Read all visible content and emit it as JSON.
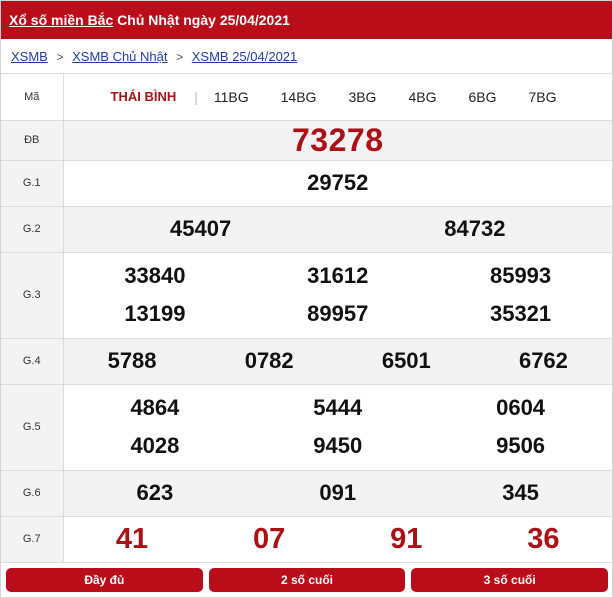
{
  "header": {
    "title_link": "Xổ số miền Bắc",
    "title_rest": " Chủ Nhật ngày 25/04/2021"
  },
  "breadcrumb": [
    {
      "label": "XSMB"
    },
    {
      "label": "XSMB Chủ Nhật"
    },
    {
      "label": "XSMB 25/04/2021"
    }
  ],
  "table": {
    "code_label": "Mã",
    "tabs": [
      "THÁI BÌNH",
      "11BG",
      "14BG",
      "3BG",
      "4BG",
      "6BG",
      "7BG"
    ],
    "prizes": [
      {
        "label": "ĐB",
        "numbers": [
          "73278"
        ]
      },
      {
        "label": "G.1",
        "numbers": [
          "29752"
        ]
      },
      {
        "label": "G.2",
        "numbers": [
          "45407",
          "84732"
        ]
      },
      {
        "label": "G.3",
        "numbers": [
          "33840",
          "31612",
          "85993",
          "13199",
          "89957",
          "35321"
        ]
      },
      {
        "label": "G.4",
        "numbers": [
          "5788",
          "0782",
          "6501",
          "6762"
        ]
      },
      {
        "label": "G.5",
        "numbers": [
          "4864",
          "5444",
          "0604",
          "4028",
          "9450",
          "9506"
        ]
      },
      {
        "label": "G.6",
        "numbers": [
          "623",
          "091",
          "345"
        ]
      },
      {
        "label": "G.7",
        "numbers": [
          "41",
          "07",
          "91",
          "36"
        ]
      }
    ]
  },
  "buttons": {
    "full": "Đầy đủ",
    "two_digits": "2 số cuối",
    "three_digits": "3 số cuối"
  },
  "colors": {
    "brand_red": "#ba0d1a",
    "number_red": "#ab1017",
    "link_blue": "#1f3f9a"
  }
}
